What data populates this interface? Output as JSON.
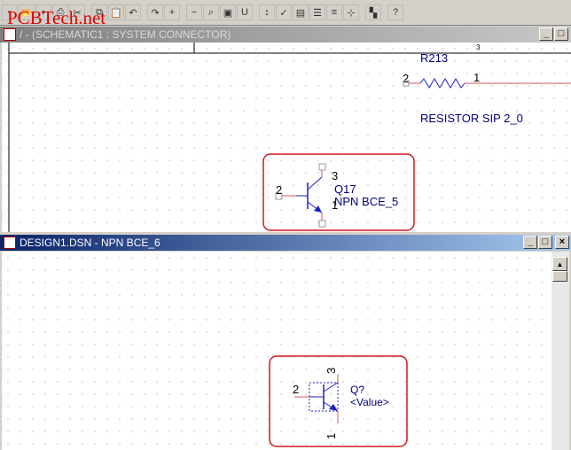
{
  "watermark": "PCBTech.net",
  "toolbar": {
    "icons": [
      [
        "new-icon",
        "▫"
      ],
      [
        "open-icon",
        "📂"
      ],
      [
        "save-icon",
        "▪"
      ],
      [
        "print-icon",
        "⎙"
      ],
      [
        "cut-icon",
        "✂"
      ],
      [
        "copy-icon",
        "⧉"
      ],
      [
        "paste-icon",
        "📋"
      ],
      [
        "undo-icon",
        "↶"
      ],
      [
        "redo-icon",
        "↷"
      ],
      [
        "zoom-in-icon",
        "+"
      ],
      [
        "zoom-out-icon",
        "−"
      ],
      [
        "zoom-area-icon",
        "⌕"
      ],
      [
        "zoom-all-icon",
        "▣"
      ],
      [
        "annotate-icon",
        "U"
      ],
      [
        "back-annotate-icon",
        "↕"
      ],
      [
        "drc-icon",
        "✓"
      ],
      [
        "netlist-icon",
        "▤"
      ],
      [
        "cross-ref-icon",
        "☰"
      ],
      [
        "bom-icon",
        "≡"
      ],
      [
        "snap-grid-icon",
        "⊹"
      ],
      [
        "project-manager-icon",
        "▚"
      ],
      [
        "help-icon",
        "?"
      ]
    ]
  },
  "upper_window": {
    "title": "/ - (SCHEMATIC1 : SYSTEM CONNECTOR)",
    "resistor": {
      "ref": "R213",
      "pin_left": "2",
      "pin_right": "1",
      "value": "RESISTOR SIP 2_0"
    },
    "transistor": {
      "ref": "Q17",
      "value": "NPN BCE_5",
      "pin_collector": "3",
      "pin_base": "2",
      "pin_emitter": "1"
    },
    "border_tick": "3"
  },
  "lower_window": {
    "title": "DESIGN1.DSN - NPN BCE_6",
    "transistor": {
      "ref": "Q?",
      "value": "<Value>",
      "pin_collector": "3",
      "pin_base": "2",
      "pin_emitter": "1"
    }
  },
  "window_buttons": {
    "minimize": "_",
    "maximize": "□",
    "close": "×"
  },
  "colors": {
    "wire": "#e05050",
    "part": "#2020c0",
    "text": "#000080",
    "highlight": "#d01818"
  }
}
